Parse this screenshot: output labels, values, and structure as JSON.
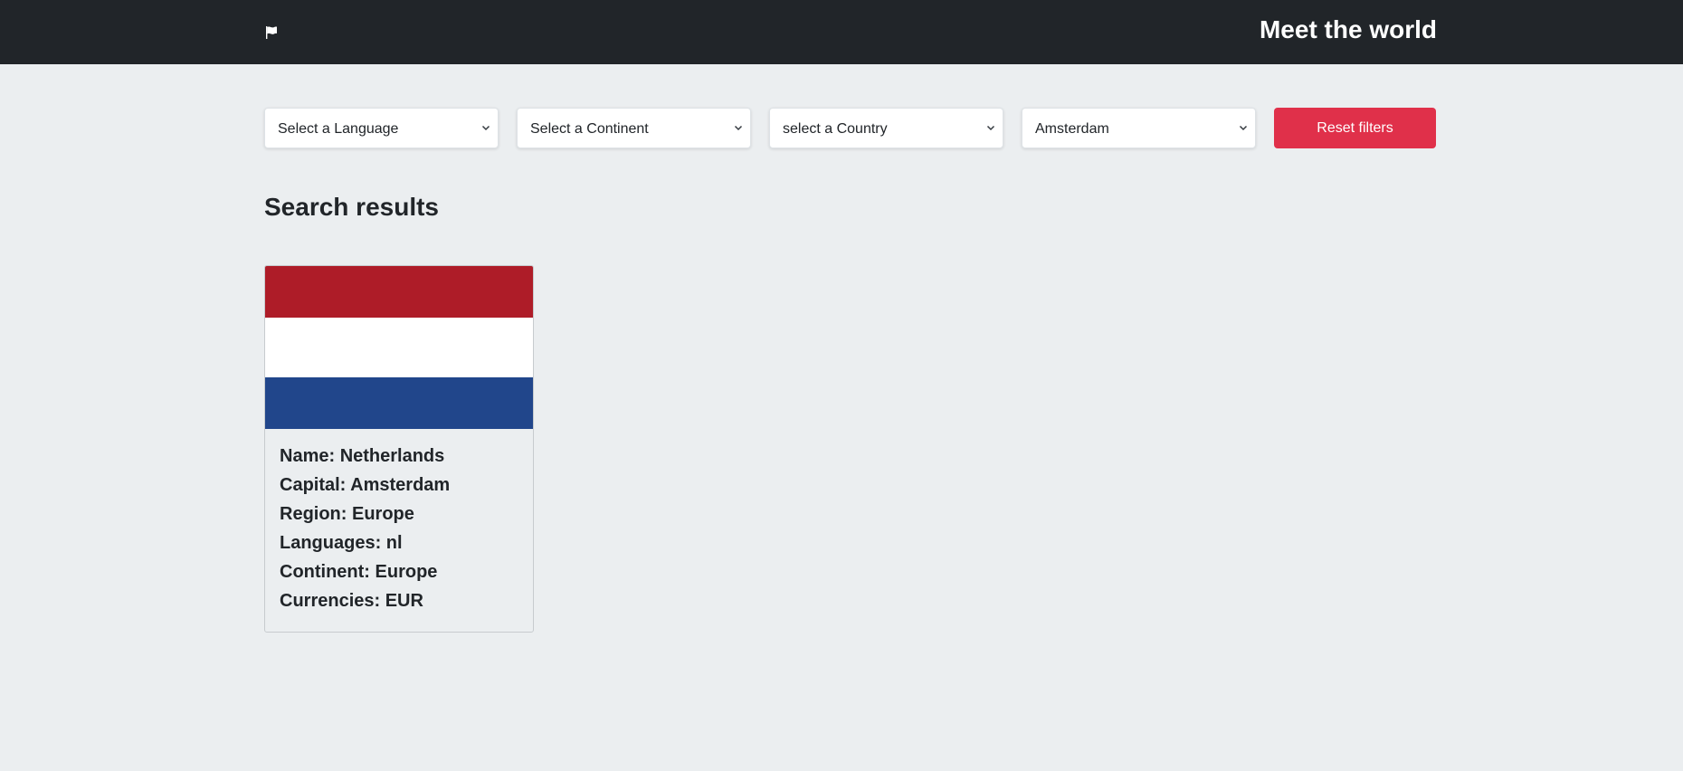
{
  "navbar": {
    "icon": "flag-icon",
    "title": "Meet the world"
  },
  "filters": {
    "language": {
      "selected": "Select a Language"
    },
    "continent": {
      "selected": "Select a Continent"
    },
    "country": {
      "selected": "select a Country"
    },
    "capital": {
      "selected": "Amsterdam"
    },
    "reset_label": "Reset filters"
  },
  "results": {
    "heading": "Search results",
    "cards": [
      {
        "flag_colors": [
          "#ae1c28",
          "#ffffff",
          "#21468b"
        ],
        "name_line": "Name: Netherlands",
        "capital_line": "Capital: Amsterdam",
        "region_line": "Region: Europe",
        "languages_line": "Languages: nl",
        "continent_line": "Continent: Europe",
        "currencies_line": "Currencies: EUR"
      }
    ]
  },
  "colors": {
    "navbar_bg": "#212529",
    "page_bg": "#ebeef0",
    "danger": "#e0304a"
  }
}
